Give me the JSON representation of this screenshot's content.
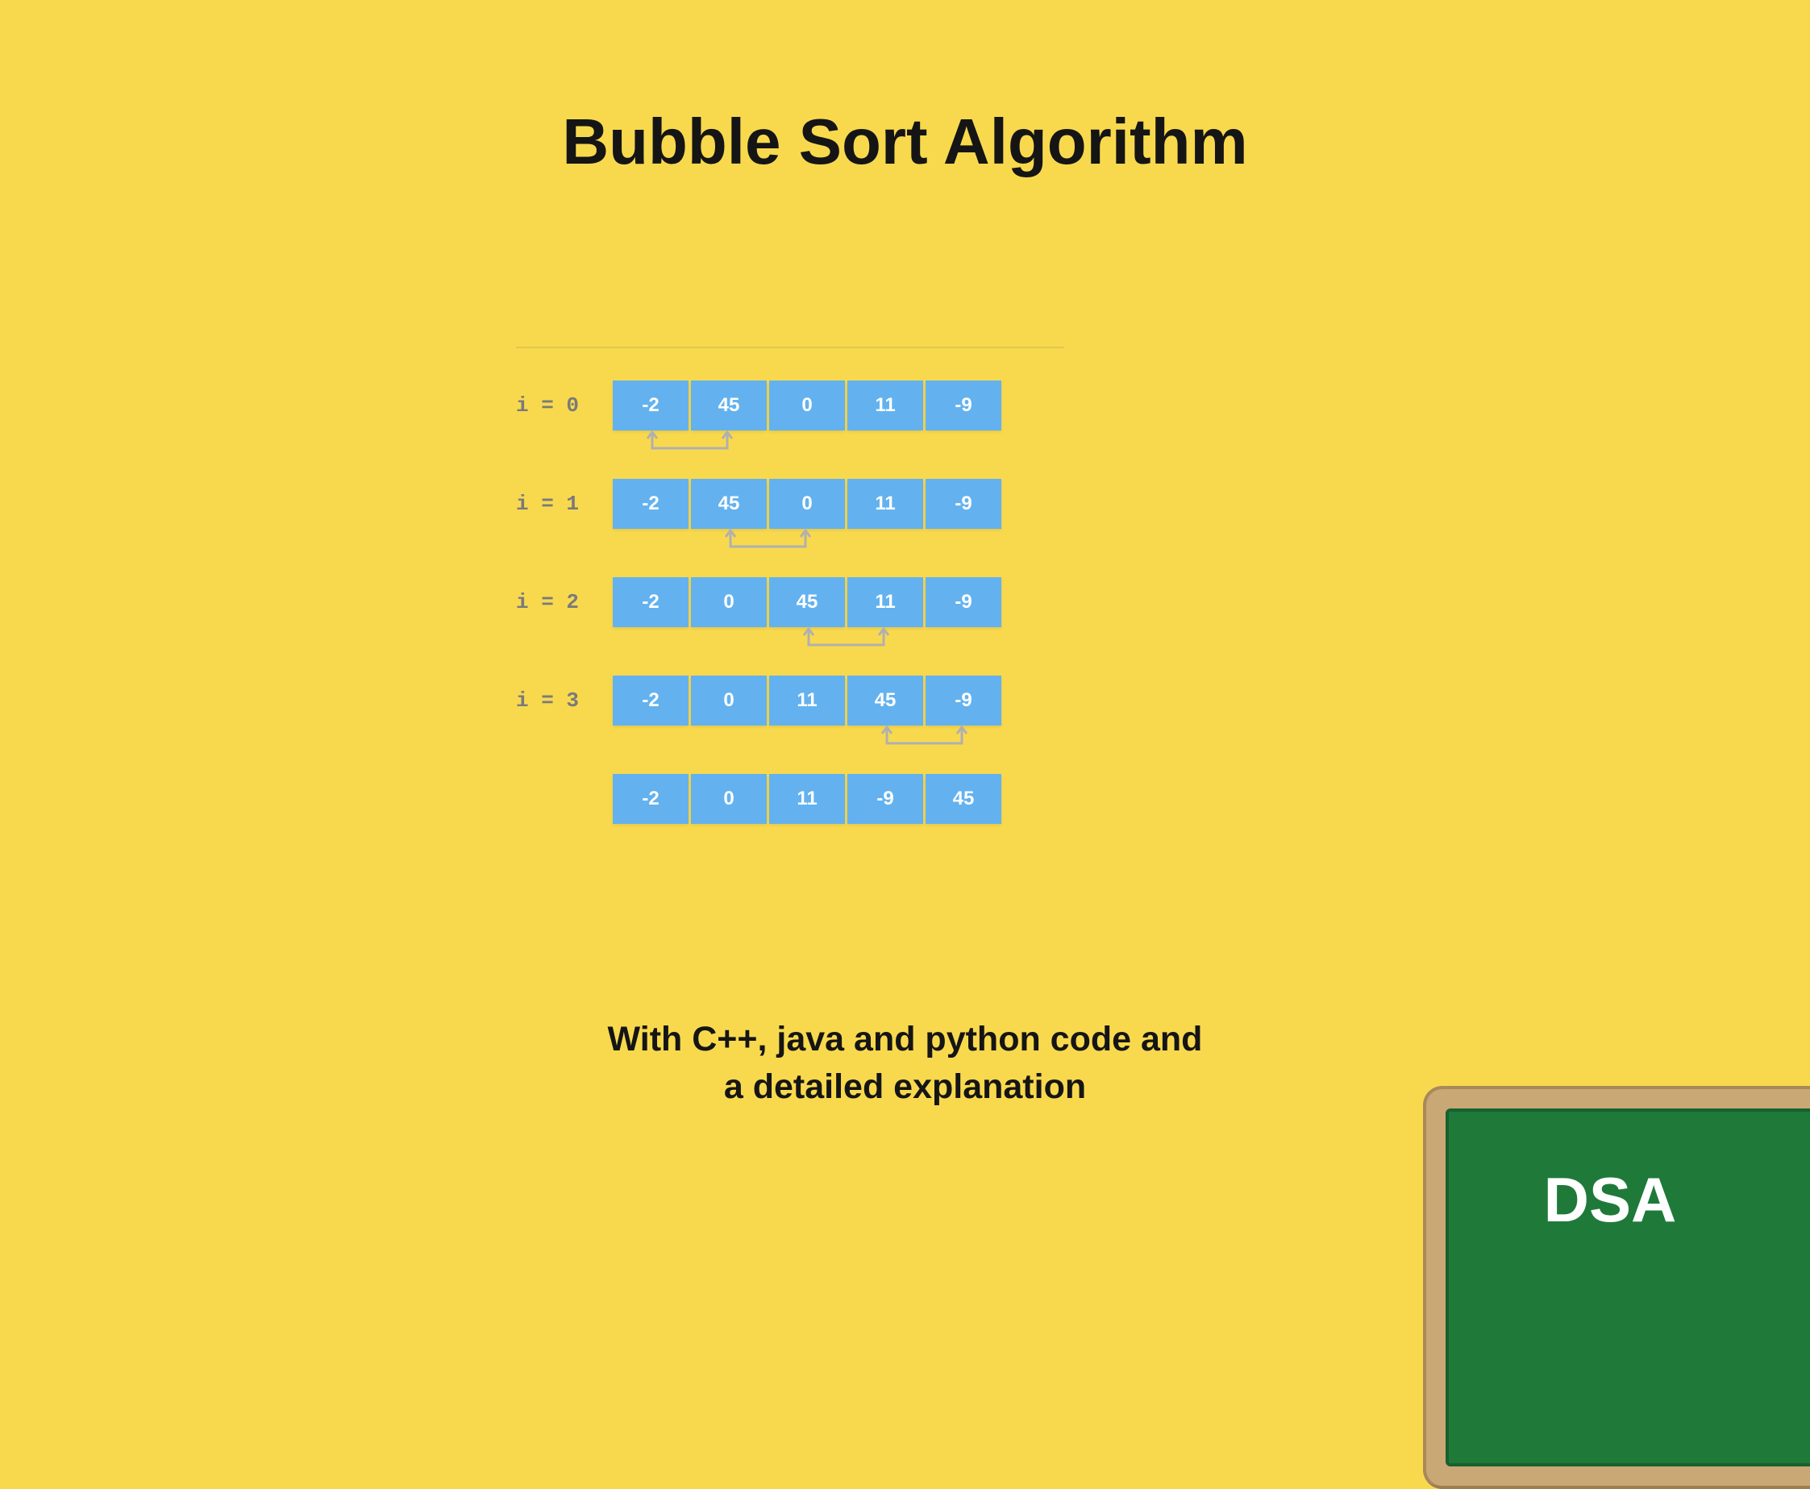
{
  "title": "Bubble Sort Algorithm",
  "subtitle_line1": "With C++, java and python  code and",
  "subtitle_line2": "a detailed explanation",
  "board_label": "DSA",
  "colors": {
    "background": "#f8d94e",
    "cell": "#63b2ef",
    "cell_text": "#ffffff",
    "label": "#7a7a7a",
    "arrow": "#b0b0b0",
    "board_frame": "#c9a875",
    "board_inner": "#1f7a3a"
  },
  "diagram": {
    "rows": [
      {
        "label": "i = 0",
        "values": [
          "-2",
          "45",
          "0",
          "11",
          "-9"
        ],
        "swap": [
          0,
          1
        ]
      },
      {
        "label": "i = 1",
        "values": [
          "-2",
          "45",
          "0",
          "11",
          "-9"
        ],
        "swap": [
          1,
          2
        ]
      },
      {
        "label": "i = 2",
        "values": [
          "-2",
          "0",
          "45",
          "11",
          "-9"
        ],
        "swap": [
          2,
          3
        ]
      },
      {
        "label": "i = 3",
        "values": [
          "-2",
          "0",
          "11",
          "45",
          "-9"
        ],
        "swap": [
          3,
          4
        ]
      },
      {
        "label": "",
        "values": [
          "-2",
          "0",
          "11",
          "-9",
          "45"
        ],
        "swap": null
      }
    ]
  }
}
